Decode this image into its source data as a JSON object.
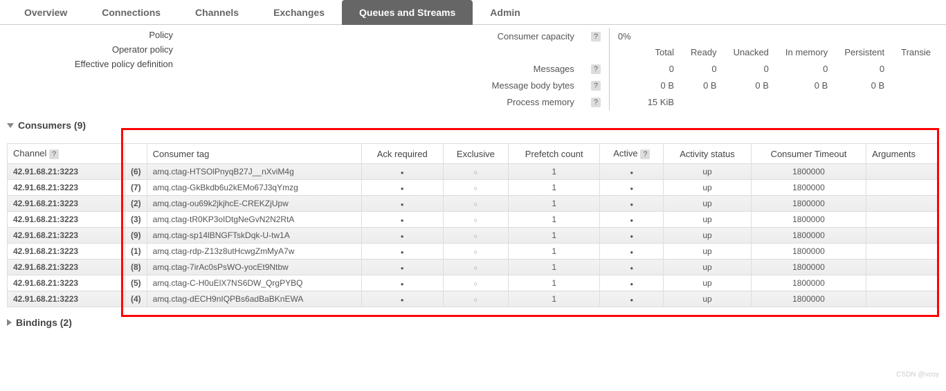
{
  "tabs": {
    "overview": "Overview",
    "connections": "Connections",
    "channels": "Channels",
    "exchanges": "Exchanges",
    "queues": "Queues and Streams",
    "admin": "Admin"
  },
  "policy": {
    "policy": "Policy",
    "operator": "Operator policy",
    "effective": "Effective policy definition"
  },
  "capacity": {
    "label": "Consumer capacity",
    "value": "0%"
  },
  "stats_headers": {
    "total": "Total",
    "ready": "Ready",
    "unacked": "Unacked",
    "in_memory": "In memory",
    "persistent": "Persistent",
    "transient": "Transie"
  },
  "stats_rows": {
    "messages": {
      "label": "Messages",
      "total": "0",
      "ready": "0",
      "unacked": "0",
      "in_memory": "0",
      "persistent": "0"
    },
    "body_bytes": {
      "label": "Message body bytes",
      "total": "0 B",
      "ready": "0 B",
      "unacked": "0 B",
      "in_memory": "0 B",
      "persistent": "0 B"
    },
    "process_memory": {
      "label": "Process memory",
      "value": "15 KiB"
    }
  },
  "sections": {
    "consumers": "Consumers (9)",
    "bindings": "Bindings (2)"
  },
  "consumer_headers": {
    "channel": "Channel",
    "tag": "Consumer tag",
    "ack": "Ack required",
    "exclusive": "Exclusive",
    "prefetch": "Prefetch count",
    "active": "Active",
    "activity_status": "Activity status",
    "timeout": "Consumer Timeout",
    "arguments": "Arguments"
  },
  "consumers": [
    {
      "channel": "42.91.68.21:3223",
      "n": "(6)",
      "tag": "amq.ctag-HTSOlPnyqB27J__nXviM4g",
      "ack": true,
      "exclusive": false,
      "prefetch": "1",
      "active": true,
      "status": "up",
      "timeout": "1800000",
      "args": ""
    },
    {
      "channel": "42.91.68.21:3223",
      "n": "(7)",
      "tag": "amq.ctag-GkBkdb6u2kEMo67J3qYmzg",
      "ack": true,
      "exclusive": false,
      "prefetch": "1",
      "active": true,
      "status": "up",
      "timeout": "1800000",
      "args": ""
    },
    {
      "channel": "42.91.68.21:3223",
      "n": "(2)",
      "tag": "amq.ctag-ou69k2jkjhcE-CREKZjUpw",
      "ack": true,
      "exclusive": false,
      "prefetch": "1",
      "active": true,
      "status": "up",
      "timeout": "1800000",
      "args": ""
    },
    {
      "channel": "42.91.68.21:3223",
      "n": "(3)",
      "tag": "amq.ctag-tR0KP3oIDtgNeGvN2N2RtA",
      "ack": true,
      "exclusive": false,
      "prefetch": "1",
      "active": true,
      "status": "up",
      "timeout": "1800000",
      "args": ""
    },
    {
      "channel": "42.91.68.21:3223",
      "n": "(9)",
      "tag": "amq.ctag-sp14lBNGFTskDqk-U-tw1A",
      "ack": true,
      "exclusive": false,
      "prefetch": "1",
      "active": true,
      "status": "up",
      "timeout": "1800000",
      "args": ""
    },
    {
      "channel": "42.91.68.21:3223",
      "n": "(1)",
      "tag": "amq.ctag-rdp-Z13z8utHcwgZmMyA7w",
      "ack": true,
      "exclusive": false,
      "prefetch": "1",
      "active": true,
      "status": "up",
      "timeout": "1800000",
      "args": ""
    },
    {
      "channel": "42.91.68.21:3223",
      "n": "(8)",
      "tag": "amq.ctag-7irAc0sPsWO-yocEt9Ntbw",
      "ack": true,
      "exclusive": false,
      "prefetch": "1",
      "active": true,
      "status": "up",
      "timeout": "1800000",
      "args": ""
    },
    {
      "channel": "42.91.68.21:3223",
      "n": "(5)",
      "tag": "amq.ctag-C-H0uElX7NS6DW_QrgPYBQ",
      "ack": true,
      "exclusive": false,
      "prefetch": "1",
      "active": true,
      "status": "up",
      "timeout": "1800000",
      "args": ""
    },
    {
      "channel": "42.91.68.21:3223",
      "n": "(4)",
      "tag": "amq.ctag-dECH9nIQPBs6adBaBKnEWA",
      "ack": true,
      "exclusive": false,
      "prefetch": "1",
      "active": true,
      "status": "up",
      "timeout": "1800000",
      "args": ""
    }
  ],
  "watermark": "CSDN @vcoy"
}
